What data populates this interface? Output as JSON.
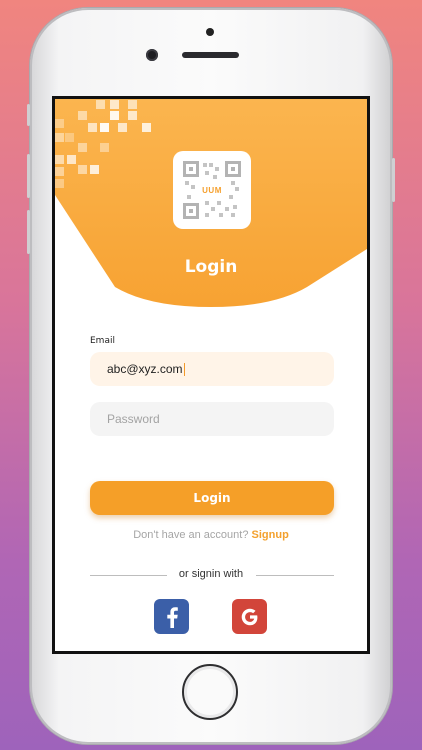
{
  "login": {
    "title": "Login",
    "logo_text": "UUM",
    "email_label": "Email",
    "email_value": "abc@xyz.com",
    "password_placeholder": "Password",
    "login_button": "Login",
    "no_account_text": "Don't have an account?",
    "signup_link": "Signup",
    "or_signin_text": "or signin with",
    "social": [
      {
        "icon": "facebook-icon",
        "color": "#3b5fa8"
      },
      {
        "icon": "google-icon",
        "color": "#d2453a"
      }
    ]
  },
  "colors": {
    "accent": "#f59f28",
    "email_field_bg": "#fff4e8",
    "password_field_bg": "#f4f4f4"
  }
}
